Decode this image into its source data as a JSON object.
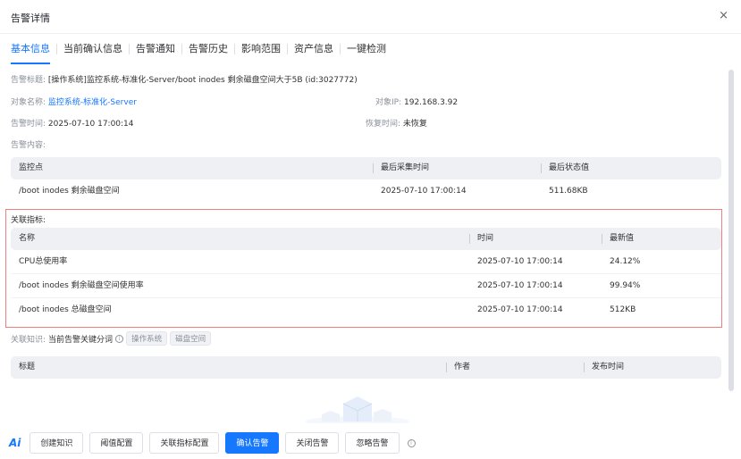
{
  "dialog": {
    "title": "告警详情",
    "close": "×"
  },
  "tabs": [
    {
      "label": "基本信息"
    },
    {
      "label": "当前确认信息"
    },
    {
      "label": "告警通知"
    },
    {
      "label": "告警历史"
    },
    {
      "label": "影响范围"
    },
    {
      "label": "资产信息"
    },
    {
      "label": "一键检测"
    }
  ],
  "basic": {
    "alarm_title_label": "告警标题:",
    "alarm_title_value": "[操作系统]监控系统-标准化-Server/boot inodes 剩余磁盘空间大于5B (id:3027772)",
    "object_name_label": "对象名称:",
    "object_name_value": "监控系统-标准化-Server",
    "object_ip_label": "对象IP:",
    "object_ip_value": "192.168.3.92",
    "alarm_time_label": "告警时间:",
    "alarm_time_value": "2025-07-10 17:00:14",
    "recover_time_label": "恢复时间:",
    "recover_time_value": "未恢复",
    "content_label": "告警内容:"
  },
  "monitor_table": {
    "headers": [
      "监控点",
      "最后采集时间",
      "最后状态值"
    ],
    "rows": [
      [
        "/boot inodes 剩余磁盘空间",
        "2025-07-10 17:00:14",
        "511.68KB"
      ]
    ]
  },
  "related_metrics": {
    "label": "关联指标:",
    "headers": [
      "名称",
      "时间",
      "最新值"
    ],
    "rows": [
      [
        "CPU总使用率",
        "2025-07-10 17:00:14",
        "24.12%"
      ],
      [
        "/boot inodes 剩余磁盘空间使用率",
        "2025-07-10 17:00:14",
        "99.94%"
      ],
      [
        "/boot inodes 总磁盘空间",
        "2025-07-10 17:00:14",
        "512KB"
      ]
    ]
  },
  "knowledge": {
    "label": "关联知识:",
    "keyword_label": "当前告警关键分词",
    "info": "i",
    "tags": [
      "操作系统",
      "磁盘空间"
    ],
    "headers": [
      "标题",
      "作者",
      "发布时间"
    ]
  },
  "footer": {
    "ai_logo": "Ai",
    "buttons": [
      "创建知识",
      "阈值配置",
      "关联指标配置",
      "确认告警",
      "关闭告警",
      "忽略告警"
    ],
    "info": "i"
  },
  "colors": {
    "accent": "#1677ff",
    "highlight_border": "#f08080"
  }
}
